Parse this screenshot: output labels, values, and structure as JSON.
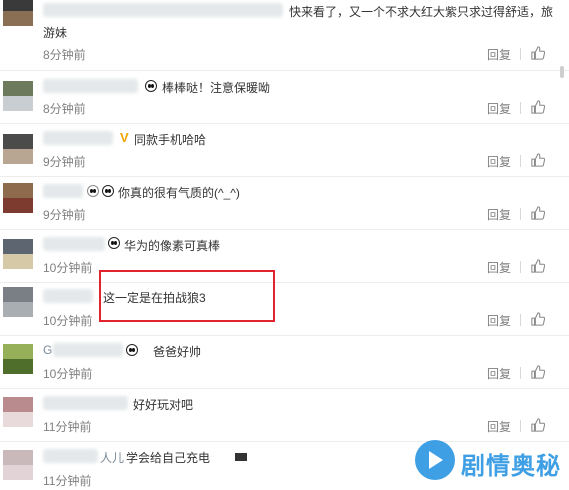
{
  "comments": [
    {
      "text": "快来看了，又一个不求大红大紫只求过得舒适，旅",
      "text2": "游妹",
      "time": "8分钟前",
      "reply": "回复",
      "avatar_colors": [
        "#3a3a3a",
        "#8a6f55"
      ]
    },
    {
      "text": "棒棒哒！注意保暖呦",
      "time": "8分钟前",
      "reply": "回复",
      "avatar_colors": [
        "#6e7a5c",
        "#c9ced3"
      ]
    },
    {
      "text": "同款手机哈哈",
      "time": "9分钟前",
      "reply": "回复",
      "avatar_colors": [
        "#4b4b4b",
        "#b8a592"
      ]
    },
    {
      "text": "你真的很有气质的(^_^)",
      "time": "9分钟前",
      "reply": "回复",
      "avatar_colors": [
        "#8e6b4d",
        "#7d3b2f"
      ]
    },
    {
      "text": "华为的像素可真棒",
      "time": "10分钟前",
      "reply": "回复",
      "avatar_colors": [
        "#5d6670",
        "#d6c9a8"
      ]
    },
    {
      "text": "这一定是在拍战狼3",
      "time": "10分钟前",
      "reply": "回复",
      "avatar_colors": [
        "#7a7f86",
        "#a9aeb3"
      ]
    },
    {
      "text": "爸爸好帅",
      "name_partial": "G",
      "time": "10分钟前",
      "reply": "回复",
      "avatar_colors": [
        "#96b05a",
        "#4f6e2c"
      ]
    },
    {
      "text": "好好玩对吧",
      "time": "11分钟前",
      "reply": "回复",
      "avatar_colors": [
        "#b98b8e",
        "#e8dada"
      ]
    },
    {
      "text": "学会给自己充电",
      "name_partial": "人儿",
      "time": "11分钟前",
      "reply": "回复",
      "avatar_colors": [
        "#c9b9ba",
        "#e2d4d6"
      ]
    }
  ],
  "watermark": {
    "text": "剧情奥秘",
    "color": "#1d8fe0"
  },
  "highlight_color": "#e0262b"
}
